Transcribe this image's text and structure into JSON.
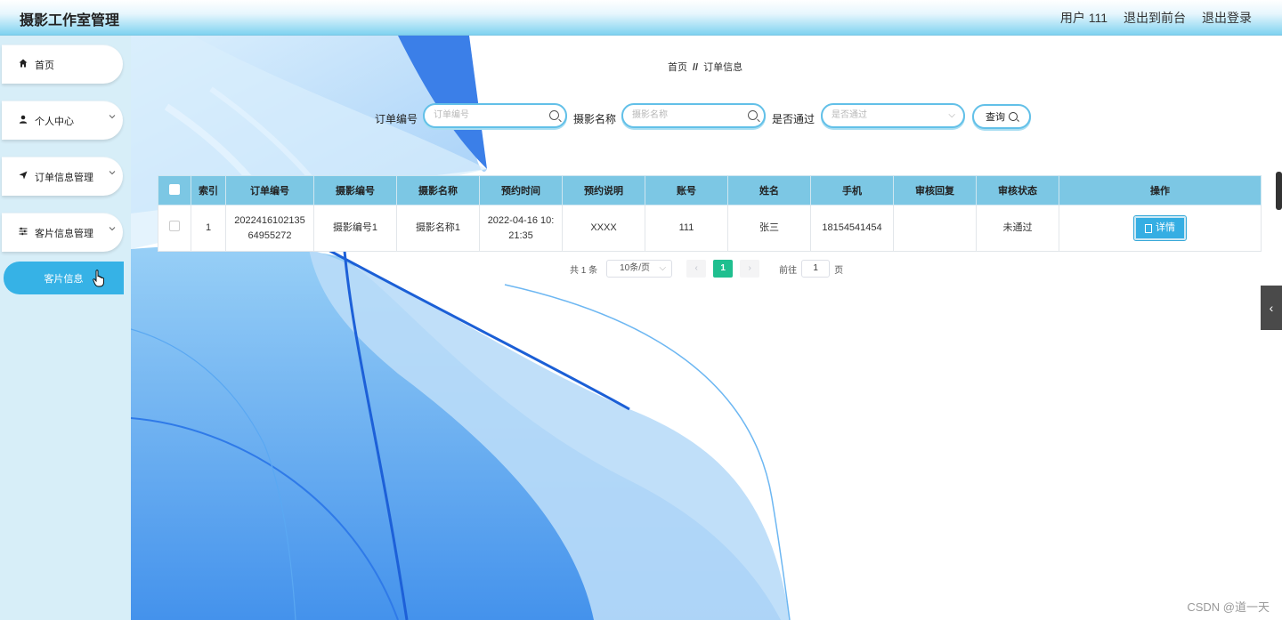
{
  "header": {
    "title": "摄影工作室管理",
    "user": "用户 111",
    "to_front": "退出到前台",
    "logout": "退出登录"
  },
  "sidebar": {
    "items": [
      {
        "label": "首页",
        "icon": "home-icon"
      },
      {
        "label": "个人中心",
        "icon": "user-icon"
      },
      {
        "label": "订单信息管理",
        "icon": "send-icon"
      },
      {
        "label": "客片信息管理",
        "icon": "sliders-icon"
      }
    ],
    "active_sub": "客片信息"
  },
  "breadcrumb": {
    "home": "首页",
    "sep": "//",
    "current": "订单信息"
  },
  "search": {
    "order_label": "订单编号",
    "order_placeholder": "订单编号",
    "name_label": "摄影名称",
    "name_placeholder": "摄影名称",
    "pass_label": "是否通过",
    "pass_placeholder": "是否通过",
    "query": "查询"
  },
  "table": {
    "headers": [
      "索引",
      "订单编号",
      "摄影编号",
      "摄影名称",
      "预约时间",
      "预约说明",
      "账号",
      "姓名",
      "手机",
      "审核回复",
      "审核状态",
      "操作"
    ],
    "rows": [
      {
        "index": "1",
        "order_no_1": "2022416102135",
        "order_no_2": "64955272",
        "photo_no": "摄影编号1",
        "photo_name": "摄影名称1",
        "time_1": "2022-04-16 10:",
        "time_2": "21:35",
        "note": "XXXX",
        "account": "111",
        "name": "张三",
        "phone": "18154541454",
        "reply": "",
        "status": "未通过",
        "action": "详情"
      }
    ]
  },
  "pagination": {
    "total": "共 1 条",
    "page_size": "10条/页",
    "current": "1",
    "goto": "前往",
    "goto_value": "1",
    "page_unit": "页"
  },
  "watermark": "CSDN @道一天",
  "colors": {
    "accent": "#36b2e6",
    "table_header": "#7cc7e4",
    "page_active": "#1fbf8f"
  }
}
